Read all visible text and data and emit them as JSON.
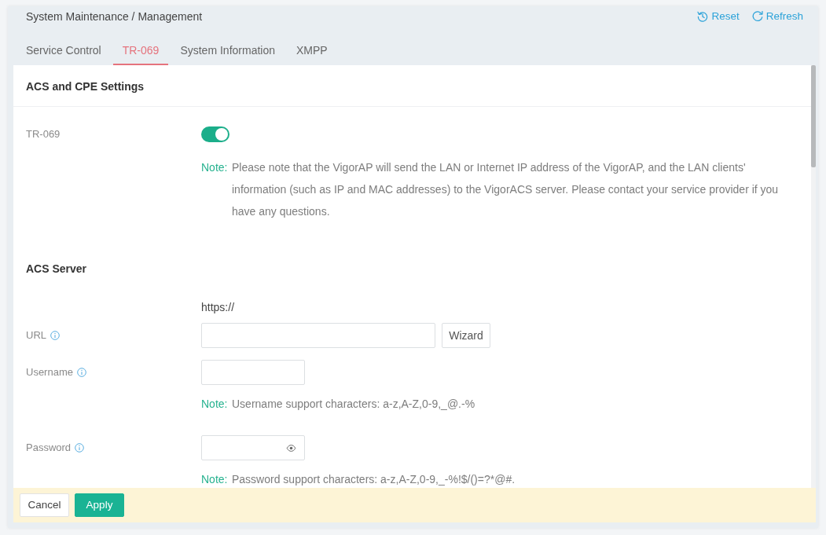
{
  "header": {
    "title": "System Maintenance / Management",
    "actions": [
      {
        "kind": "reset",
        "label": "Reset"
      },
      {
        "kind": "refresh",
        "label": "Refresh"
      }
    ]
  },
  "tabs": [
    {
      "label": "Service Control",
      "selected": false
    },
    {
      "label": "TR-069",
      "selected": true
    },
    {
      "label": "System Information",
      "selected": false
    },
    {
      "label": "XMPP",
      "selected": false
    }
  ],
  "settings": {
    "title": "ACS and CPE Settings",
    "tr069": {
      "label": "TR-069",
      "on": true,
      "note_label": "Note:",
      "note": "Please note that the VigorAP will send the LAN or Internet IP address of the VigorAP, and the LAN clients' information (such as IP and MAC addresses) to the VigorACS server. Please contact your service provider if you have any questions."
    }
  },
  "acs_server": {
    "title": "ACS Server",
    "fields": [
      {
        "kind": "url",
        "label": "URL",
        "prefix": "https://",
        "button": "Wizard"
      },
      {
        "kind": "text",
        "label": "Username",
        "note_label": "Note:",
        "note": "Username support characters: a-z,A-Z,0-9,_@.-%"
      },
      {
        "kind": "password",
        "label": "Password",
        "note_label": "Note:",
        "note": "Password support characters: a-z,A-Z,0-9,_-%!$/()=?*@#."
      }
    ]
  },
  "footer": {
    "buttons": [
      {
        "kind": "secondary",
        "label": "Cancel"
      },
      {
        "kind": "primary",
        "label": "Apply"
      }
    ]
  }
}
